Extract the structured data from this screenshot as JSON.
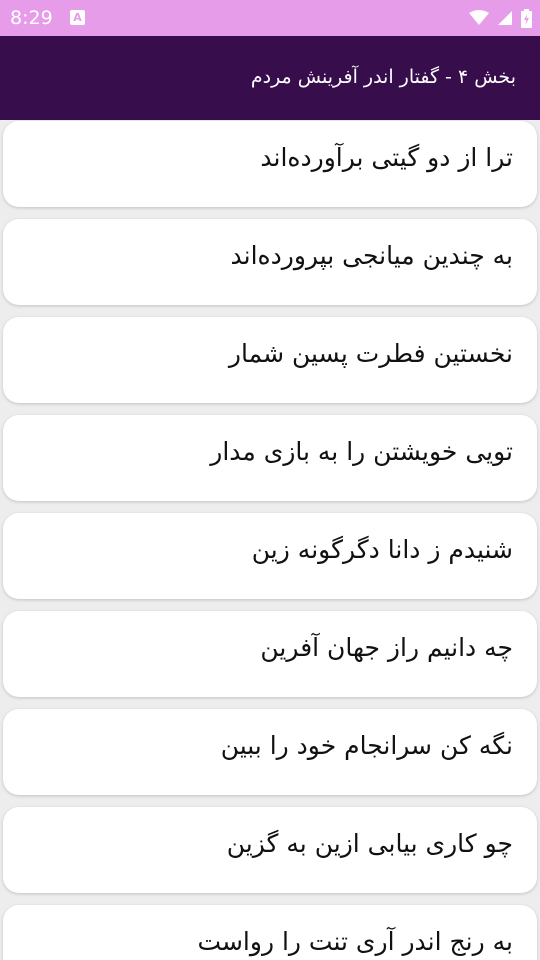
{
  "status_bar": {
    "time": "8:29",
    "notification_icon": "A",
    "icons": [
      "wifi-icon",
      "signal-icon",
      "battery-icon"
    ]
  },
  "app_bar": {
    "title": "بخش ۴ - گفتار اندر آفرینش مردم"
  },
  "verses": [
    "ترا از دو گیتی برآورده‌اند",
    "به چندین میانجی بپرورده‌اند",
    "نخستین فطرت پسین شمار",
    "تویی خویشتن را به بازی مدار",
    "شنیدم ز دانا دگرگونه زین",
    "چه دانیم راز جهان آفرین",
    "نگه کن سرانجام خود را ببین",
    "چو کاری بیابی ازین به گزین",
    "به رنج اندر آری تنت را رواست"
  ],
  "colors": {
    "status_bar": "#e79ce9",
    "app_bar": "#370d4c",
    "background": "#ededed",
    "card": "#ffffff"
  }
}
